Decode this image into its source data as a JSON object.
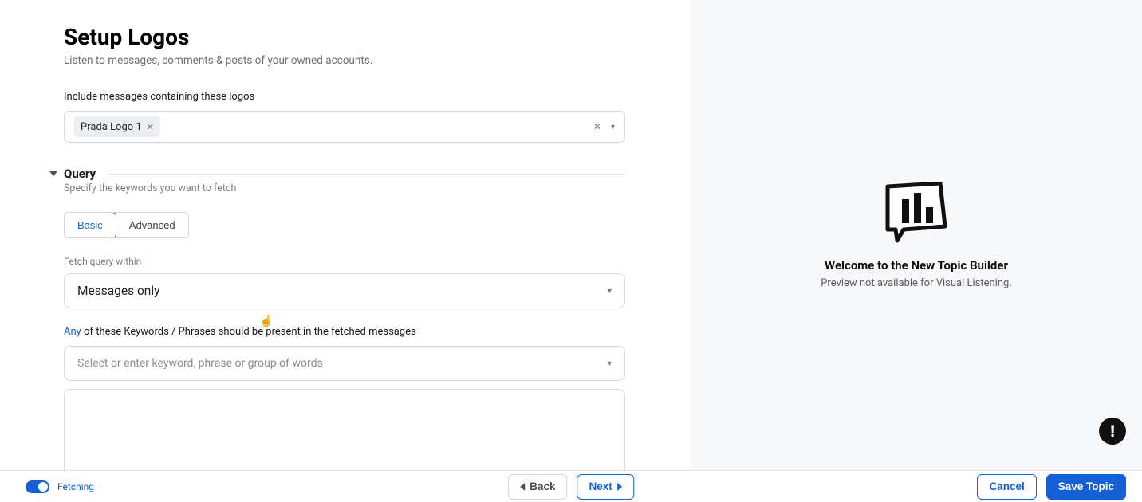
{
  "header": {
    "title": "Setup Logos",
    "subtitle": "Listen to messages, comments & posts of your owned accounts."
  },
  "logos": {
    "field_label": "Include messages containing these logos",
    "chips": [
      {
        "label": "Prada Logo 1"
      }
    ]
  },
  "query": {
    "section_title": "Query",
    "section_subtitle": "Specify the keywords you want to fetch",
    "tabs": {
      "basic": "Basic",
      "advanced": "Advanced",
      "active": "basic"
    },
    "fetch_within_label": "Fetch query within",
    "fetch_within_value": "Messages only",
    "keywords_line": {
      "any": "Any",
      "rest": " of these Keywords / Phrases should be present in the fetched messages"
    },
    "keywords_placeholder": "Select or enter keyword, phrase or group of words"
  },
  "preview": {
    "title": "Welcome to the New Topic Builder",
    "subtitle": "Preview not available for Visual Listening."
  },
  "footer": {
    "toggle_label": "Fetching",
    "back": "Back",
    "next": "Next",
    "cancel": "Cancel",
    "save": "Save Topic"
  }
}
